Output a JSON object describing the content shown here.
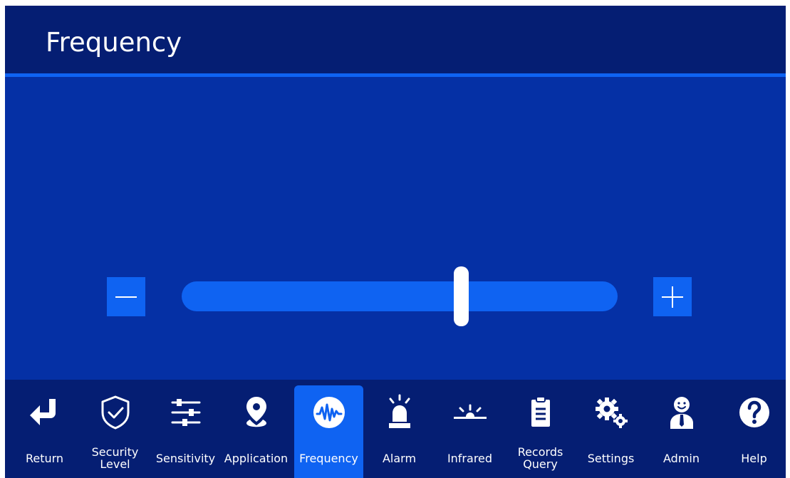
{
  "page": {
    "title": "Frequency"
  },
  "slider": {
    "value_fraction": 0.64,
    "decrease_icon": "minus-icon",
    "increase_icon": "plus-icon"
  },
  "colors": {
    "background": "#0530a5",
    "header": "#051e73",
    "accent": "#0f63f2",
    "text": "#ffffff"
  },
  "nav": {
    "items": [
      {
        "label": "Return",
        "icon": "return-arrow-icon"
      },
      {
        "label": "Security\nLevel",
        "icon": "shield-check-icon"
      },
      {
        "label": "Sensitivity",
        "icon": "sliders-icon"
      },
      {
        "label": "Application",
        "icon": "map-pin-icon"
      },
      {
        "label": "Frequency",
        "icon": "waveform-icon",
        "active": true
      },
      {
        "label": "Alarm",
        "icon": "alarm-siren-icon"
      },
      {
        "label": "Infrared",
        "icon": "infrared-icon"
      },
      {
        "label": "Records\nQuery",
        "icon": "clipboard-icon"
      },
      {
        "label": "Settings",
        "icon": "gears-icon"
      },
      {
        "label": "Admin",
        "icon": "admin-user-icon"
      },
      {
        "label": "Help",
        "icon": "help-icon"
      }
    ]
  }
}
